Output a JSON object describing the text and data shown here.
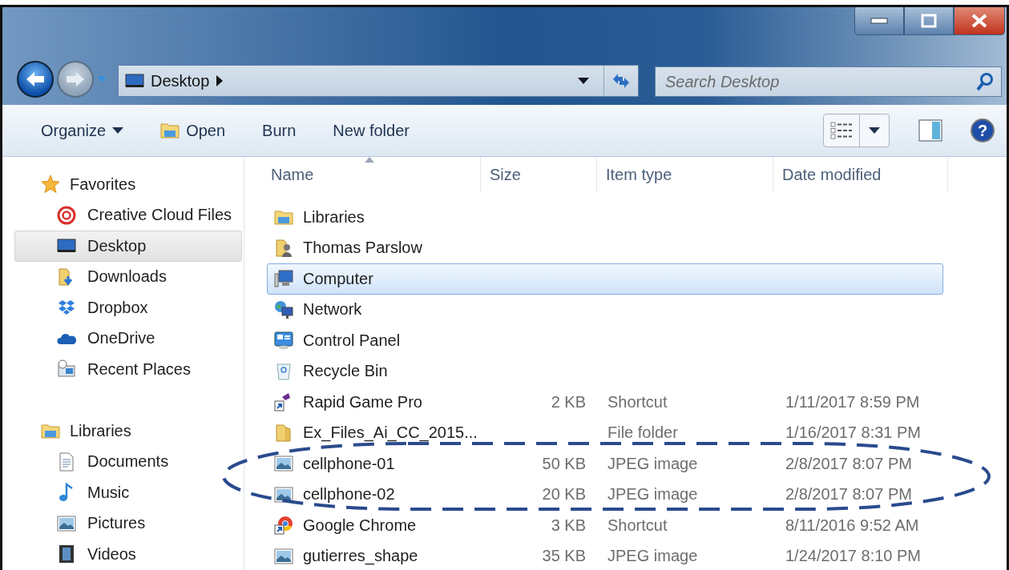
{
  "address_bar": {
    "location": "Desktop"
  },
  "search": {
    "placeholder": "Search Desktop"
  },
  "toolbar": {
    "buttons": [
      {
        "label": "Organize",
        "kind": "menu"
      },
      {
        "label": "Open",
        "kind": "open"
      },
      {
        "label": "Burn",
        "kind": "plain"
      },
      {
        "label": "New folder",
        "kind": "plain"
      }
    ],
    "help": "?"
  },
  "sidebar": {
    "groups": [
      {
        "label": "Favorites",
        "kind": "favorites",
        "items": [
          {
            "label": "Creative Cloud Files",
            "kind": "creativecloud",
            "selected": false
          },
          {
            "label": "Desktop",
            "kind": "desktop",
            "selected": true
          },
          {
            "label": "Downloads",
            "kind": "downloads",
            "selected": false
          },
          {
            "label": "Dropbox",
            "kind": "dropbox",
            "selected": false
          },
          {
            "label": "OneDrive",
            "kind": "onedrive",
            "selected": false
          },
          {
            "label": "Recent Places",
            "kind": "recent",
            "selected": false
          }
        ]
      },
      {
        "label": "Libraries",
        "kind": "libraries",
        "items": [
          {
            "label": "Documents",
            "kind": "documents",
            "selected": false
          },
          {
            "label": "Music",
            "kind": "music",
            "selected": false
          },
          {
            "label": "Pictures",
            "kind": "image",
            "selected": false
          },
          {
            "label": "Videos",
            "kind": "videos",
            "selected": false
          }
        ]
      }
    ]
  },
  "table": {
    "columns": [
      "Name",
      "Size",
      "Item type",
      "Date modified"
    ],
    "rows": [
      {
        "name": "Libraries",
        "kind": "libraries",
        "selected": false
      },
      {
        "name": "Thomas Parslow",
        "kind": "user",
        "selected": false
      },
      {
        "name": "Computer",
        "kind": "computer",
        "selected": true
      },
      {
        "name": "Network",
        "kind": "network",
        "selected": false
      },
      {
        "name": "Control Panel",
        "kind": "controlpanel",
        "selected": false
      },
      {
        "name": "Recycle Bin",
        "kind": "recyclebin",
        "selected": false
      },
      {
        "name": "Rapid Game Pro",
        "kind": "shortcut",
        "size": "2 KB",
        "type": "Shortcut",
        "date": "1/11/2017 8:59 PM",
        "selected": false
      },
      {
        "name": "Ex_Files_Ai_CC_2015...",
        "kind": "folder",
        "type": "File folder",
        "date": "1/16/2017 8:31 PM",
        "selected": false
      },
      {
        "name": "cellphone-01",
        "kind": "image",
        "size": "50 KB",
        "type": "JPEG image",
        "date": "2/8/2017 8:07 PM",
        "selected": false
      },
      {
        "name": "cellphone-02",
        "kind": "image",
        "size": "20 KB",
        "type": "JPEG image",
        "date": "2/8/2017 8:07 PM",
        "selected": false
      },
      {
        "name": "Google Chrome",
        "kind": "chrome",
        "size": "3 KB",
        "type": "Shortcut",
        "date": "8/11/2016 9:52 AM",
        "selected": false
      },
      {
        "name": "gutierres_shape",
        "kind": "image",
        "size": "35 KB",
        "type": "JPEG image",
        "date": "1/24/2017 8:10 PM",
        "selected": false
      }
    ]
  }
}
